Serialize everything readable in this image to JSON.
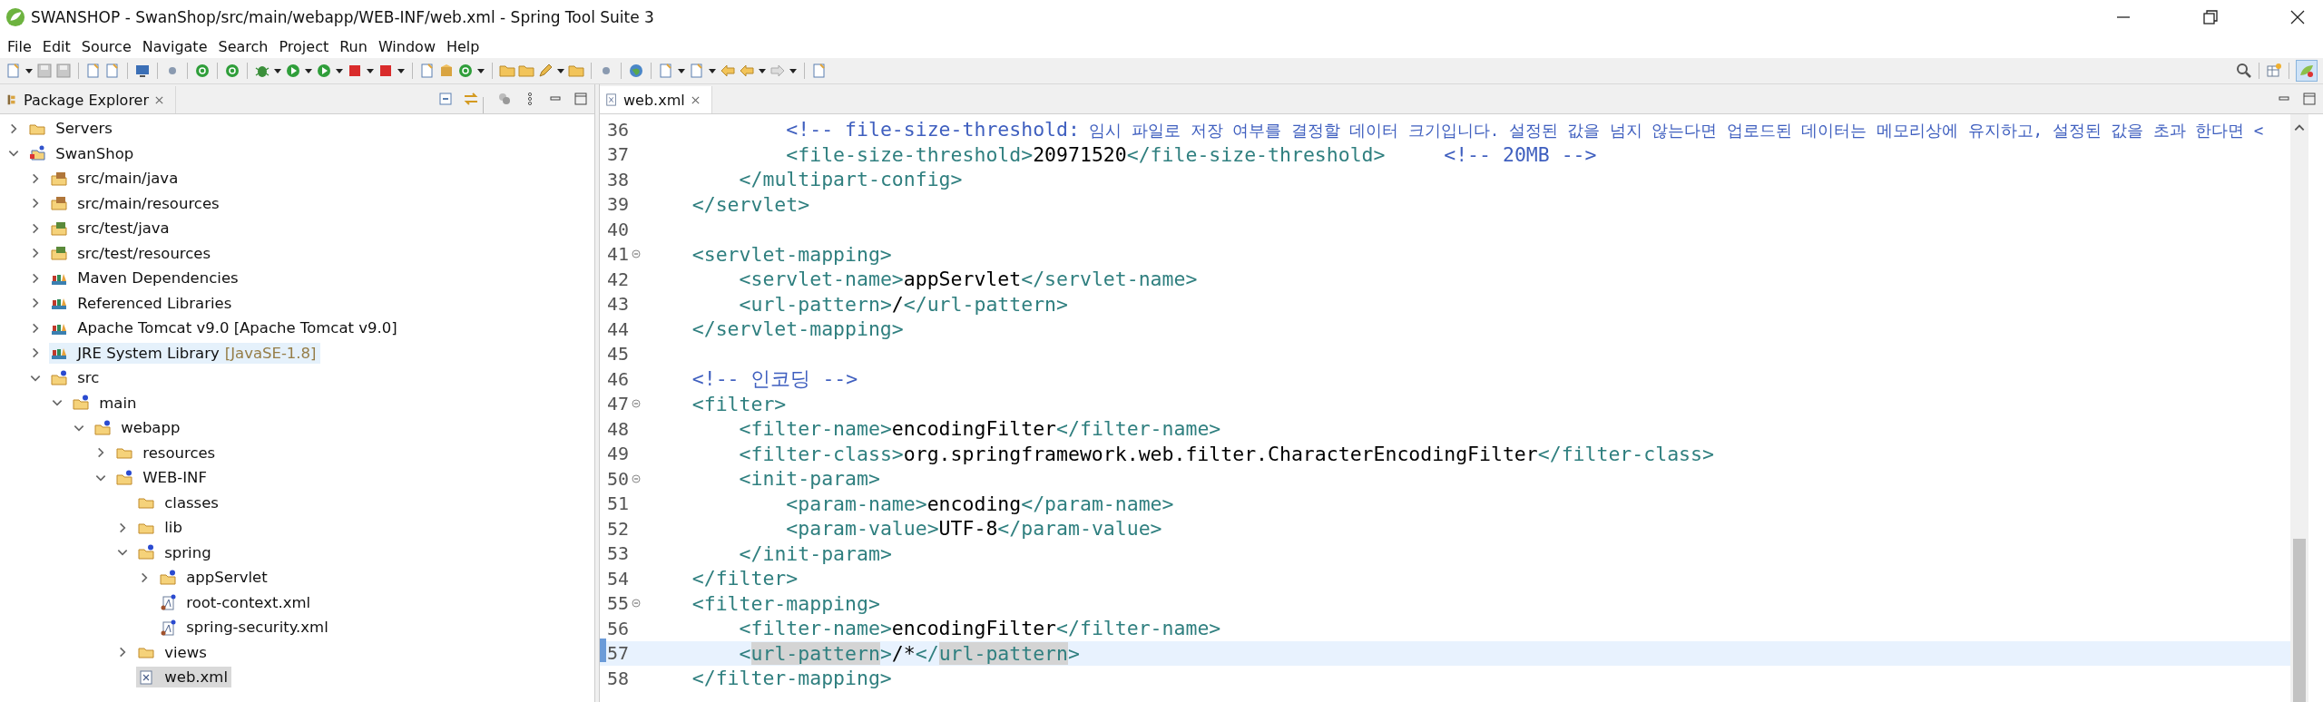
{
  "window": {
    "title": "SWANSHOP - SwanShop/src/main/webapp/WEB-INF/web.xml - Spring Tool Suite 3"
  },
  "menu": [
    "File",
    "Edit",
    "Source",
    "Navigate",
    "Search",
    "Project",
    "Run",
    "Window",
    "Help"
  ],
  "package_explorer": {
    "title": "Package Explorer",
    "tree": [
      {
        "label": "Servers",
        "kind": "folder",
        "expanded": false,
        "selected": false,
        "hovered": false
      },
      {
        "label": "SwanShop",
        "kind": "project",
        "expanded": true,
        "selected": false,
        "hovered": false,
        "children": [
          {
            "label": "src/main/java",
            "kind": "package-folder",
            "expanded": false,
            "selected": false,
            "hovered": false
          },
          {
            "label": "src/main/resources",
            "kind": "package-folder",
            "expanded": false,
            "selected": false,
            "hovered": false
          },
          {
            "label": "src/test/java",
            "kind": "test-folder",
            "expanded": false,
            "selected": false,
            "hovered": false
          },
          {
            "label": "src/test/resources",
            "kind": "test-folder",
            "expanded": false,
            "selected": false,
            "hovered": false
          },
          {
            "label": "Maven Dependencies",
            "kind": "library",
            "expanded": false,
            "selected": false,
            "hovered": false
          },
          {
            "label": "Referenced Libraries",
            "kind": "library",
            "expanded": false,
            "selected": false,
            "hovered": false
          },
          {
            "label": "Apache Tomcat v9.0 [Apache Tomcat v9.0]",
            "kind": "library",
            "expanded": false,
            "selected": false,
            "hovered": false
          },
          {
            "label": "JRE System Library",
            "decoration": "[JavaSE-1.8]",
            "kind": "library",
            "expanded": false,
            "selected": false,
            "hovered": true
          },
          {
            "label": "src",
            "kind": "spring-folder",
            "expanded": true,
            "selected": false,
            "hovered": false,
            "children": [
              {
                "label": "main",
                "kind": "spring-folder",
                "expanded": true,
                "selected": false,
                "hovered": false,
                "children": [
                  {
                    "label": "webapp",
                    "kind": "spring-folder",
                    "expanded": true,
                    "selected": false,
                    "hovered": false,
                    "children": [
                      {
                        "label": "resources",
                        "kind": "folder",
                        "expanded": false,
                        "selected": false,
                        "hovered": false
                      },
                      {
                        "label": "WEB-INF",
                        "kind": "spring-folder",
                        "expanded": true,
                        "selected": false,
                        "hovered": false,
                        "children": [
                          {
                            "label": "classes",
                            "kind": "folder",
                            "selected": false,
                            "hovered": false
                          },
                          {
                            "label": "lib",
                            "kind": "folder",
                            "expanded": false,
                            "selected": false,
                            "hovered": false
                          },
                          {
                            "label": "spring",
                            "kind": "spring-folder",
                            "expanded": true,
                            "selected": false,
                            "hovered": false,
                            "children": [
                              {
                                "label": "appServlet",
                                "kind": "spring-folder",
                                "expanded": false,
                                "selected": false,
                                "hovered": false
                              },
                              {
                                "label": "root-context.xml",
                                "kind": "spring-xml",
                                "selected": false,
                                "hovered": false
                              },
                              {
                                "label": "spring-security.xml",
                                "kind": "spring-xml",
                                "selected": false,
                                "hovered": false
                              }
                            ]
                          },
                          {
                            "label": "views",
                            "kind": "folder",
                            "expanded": false,
                            "selected": false,
                            "hovered": false
                          },
                          {
                            "label": "web.xml",
                            "kind": "xml-file",
                            "selected": true,
                            "hovered": false
                          }
                        ]
                      }
                    ]
                  }
                ]
              }
            ]
          }
        ]
      }
    ]
  },
  "editor": {
    "tab": {
      "title": "web.xml",
      "selected": true
    },
    "lines": [
      {
        "number": "36",
        "fold": false,
        "current": false,
        "segments": [
          {
            "kind": "comment",
            "text": "            <!-- file-size-threshold:"
          },
          {
            "kind": "prose",
            "text": " 임시 파일로 저장 여부를 결정할 데이터 크기입니다. 설정된 값을 넘지 않는다면 업로드된 데이터는 메모리상에 유지하고, 설정된 값을 초과 한다면 <"
          }
        ]
      },
      {
        "number": "37",
        "fold": false,
        "current": false,
        "segments": [
          {
            "kind": "tag",
            "text": "            <file-size-threshold>"
          },
          {
            "kind": "text",
            "text": "20971520"
          },
          {
            "kind": "tag",
            "text": "</file-size-threshold>"
          },
          {
            "kind": "comment",
            "text": "     <!-- 20MB -->"
          }
        ]
      },
      {
        "number": "38",
        "fold": false,
        "current": false,
        "segments": [
          {
            "kind": "tag",
            "text": "        </multipart-config>"
          }
        ]
      },
      {
        "number": "39",
        "fold": false,
        "current": false,
        "segments": [
          {
            "kind": "tag",
            "text": "    </servlet>"
          }
        ]
      },
      {
        "number": "40",
        "fold": false,
        "current": false
      },
      {
        "number": "41",
        "fold": true,
        "current": false,
        "segments": [
          {
            "kind": "tag",
            "text": "    <servlet-mapping>"
          }
        ]
      },
      {
        "number": "42",
        "fold": false,
        "current": false,
        "segments": [
          {
            "kind": "tag",
            "text": "        <servlet-name>"
          },
          {
            "kind": "text",
            "text": "appServlet"
          },
          {
            "kind": "tag",
            "text": "</servlet-name>"
          }
        ]
      },
      {
        "number": "43",
        "fold": false,
        "current": false,
        "segments": [
          {
            "kind": "tag",
            "text": "        <url-pattern>"
          },
          {
            "kind": "text",
            "text": "/"
          },
          {
            "kind": "tag",
            "text": "</url-pattern>"
          }
        ]
      },
      {
        "number": "44",
        "fold": false,
        "current": false,
        "segments": [
          {
            "kind": "tag",
            "text": "    </servlet-mapping>"
          }
        ]
      },
      {
        "number": "45",
        "fold": false,
        "current": false
      },
      {
        "number": "46",
        "fold": false,
        "current": false,
        "segments": [
          {
            "kind": "comment",
            "text": "    <!-- 인코딩 -->"
          }
        ]
      },
      {
        "number": "47",
        "fold": true,
        "current": false,
        "segments": [
          {
            "kind": "tag",
            "text": "    <filter>"
          }
        ]
      },
      {
        "number": "48",
        "fold": false,
        "current": false,
        "segments": [
          {
            "kind": "tag",
            "text": "        <filter-name>"
          },
          {
            "kind": "text",
            "text": "encodingFilter"
          },
          {
            "kind": "tag",
            "text": "</filter-name>"
          }
        ]
      },
      {
        "number": "49",
        "fold": false,
        "current": false,
        "segments": [
          {
            "kind": "tag",
            "text": "        <filter-class>"
          },
          {
            "kind": "text",
            "text": "org.springframework.web.filter.CharacterEncodingFilter"
          },
          {
            "kind": "tag",
            "text": "</filter-class>"
          }
        ]
      },
      {
        "number": "50",
        "fold": true,
        "current": false,
        "segments": [
          {
            "kind": "tag",
            "text": "        <init-param>"
          }
        ]
      },
      {
        "number": "51",
        "fold": false,
        "current": false,
        "segments": [
          {
            "kind": "tag",
            "text": "            <param-name>"
          },
          {
            "kind": "text",
            "text": "encoding"
          },
          {
            "kind": "tag",
            "text": "</param-name>"
          }
        ]
      },
      {
        "number": "52",
        "fold": false,
        "current": false,
        "segments": [
          {
            "kind": "tag",
            "text": "            <param-value>"
          },
          {
            "kind": "text",
            "text": "UTF-8"
          },
          {
            "kind": "tag",
            "text": "</param-value>"
          }
        ]
      },
      {
        "number": "53",
        "fold": false,
        "current": false,
        "segments": [
          {
            "kind": "tag",
            "text": "        </init-param>"
          }
        ]
      },
      {
        "number": "54",
        "fold": false,
        "current": false,
        "segments": [
          {
            "kind": "tag",
            "text": "    </filter>"
          }
        ]
      },
      {
        "number": "55",
        "fold": true,
        "current": false,
        "segments": [
          {
            "kind": "tag",
            "text": "    <filter-mapping>"
          }
        ]
      },
      {
        "number": "56",
        "fold": false,
        "current": false,
        "segments": [
          {
            "kind": "tag",
            "text": "        <filter-name>"
          },
          {
            "kind": "text",
            "text": "encodingFilter"
          },
          {
            "kind": "tag",
            "text": "</filter-name>"
          }
        ]
      },
      {
        "number": "57",
        "fold": false,
        "current": true,
        "segments": [
          {
            "kind": "tag",
            "text": "        <"
          },
          {
            "kind": "mark",
            "text": "url-pattern"
          },
          {
            "kind": "tag",
            "text": ">"
          },
          {
            "kind": "text",
            "text": "/*"
          },
          {
            "kind": "tag",
            "text": "</"
          },
          {
            "kind": "mark",
            "text": "url-pattern"
          },
          {
            "kind": "tag",
            "text": ">"
          }
        ]
      },
      {
        "number": "58",
        "fold": false,
        "current": false,
        "segments": [
          {
            "kind": "tag",
            "text": "    </filter-mapping>"
          }
        ]
      }
    ]
  }
}
